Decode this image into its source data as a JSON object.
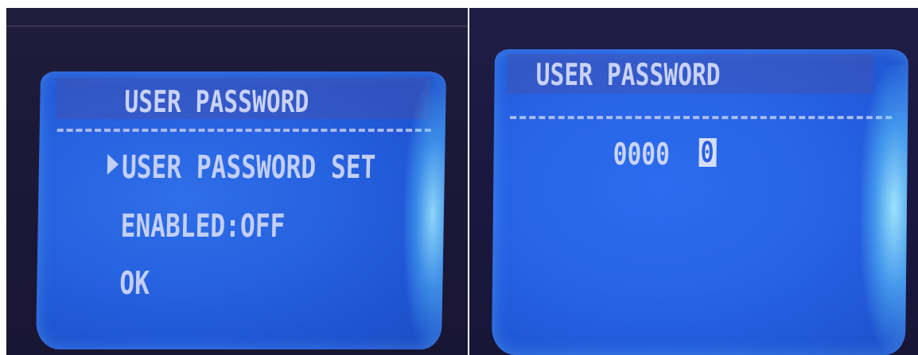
{
  "left_screen": {
    "title": "USER PASSWORD",
    "items": [
      {
        "label": "USER PASSWORD SET",
        "selected": true
      },
      {
        "label": "ENABLED:OFF",
        "selected": false
      },
      {
        "label": "OK",
        "selected": false
      }
    ]
  },
  "right_screen": {
    "title": "USER PASSWORD",
    "password_digits": "0000",
    "cursor_digit": "0"
  },
  "colors": {
    "screen_blue": "#2764e6",
    "text": "#c3cff5",
    "bezel": "#1c1838"
  }
}
